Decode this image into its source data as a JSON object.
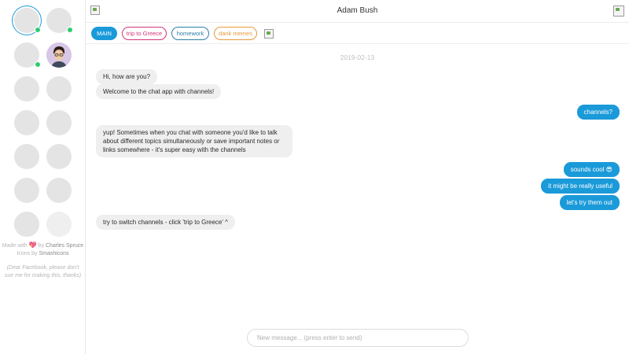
{
  "header": {
    "contact_name": "Adam Bush"
  },
  "tabs": [
    {
      "label": "MAIN",
      "color": "#1a9ad9",
      "active": true
    },
    {
      "label": "trip to Greece",
      "color": "#d3357a",
      "active": false
    },
    {
      "label": "homework",
      "color": "#2d7fa8",
      "active": false
    },
    {
      "label": "dank memes",
      "color": "#e89a3c",
      "active": false
    }
  ],
  "conversation": {
    "date": "2019-02-13",
    "messages": [
      {
        "direction": "in",
        "text": "Hi, how are you?"
      },
      {
        "direction": "in",
        "text": "Welcome to the chat app with channels!"
      },
      {
        "direction": "out",
        "text": "channels?"
      },
      {
        "direction": "in",
        "text": "yup! Sometimes when you chat with someone you'd like to talk about different topics simultaneously or save important notes or links somewhere - it's super easy with the channels"
      },
      {
        "direction": "out",
        "text": "sounds cool 😎"
      },
      {
        "direction": "out",
        "text": "it might be really useful"
      },
      {
        "direction": "out",
        "text": "let's try them out"
      },
      {
        "direction": "in",
        "text": "try to switch channels - click 'trip to Greece' ^"
      }
    ]
  },
  "composer": {
    "placeholder": "New message... (press enter to send)"
  },
  "sidebar": {
    "credits": {
      "made_with": "Made with",
      "heart": "💖",
      "by": "by",
      "author": "Charles Spruce",
      "icons_by": "Icons by",
      "icons_author": "Smashicons",
      "note": "(Dear Facebook, please don't sue me for making this, thanks)"
    }
  },
  "colors": {
    "accent": "#1a9ad9",
    "online": "#2ecc71",
    "incoming_bubble": "#efefef"
  }
}
